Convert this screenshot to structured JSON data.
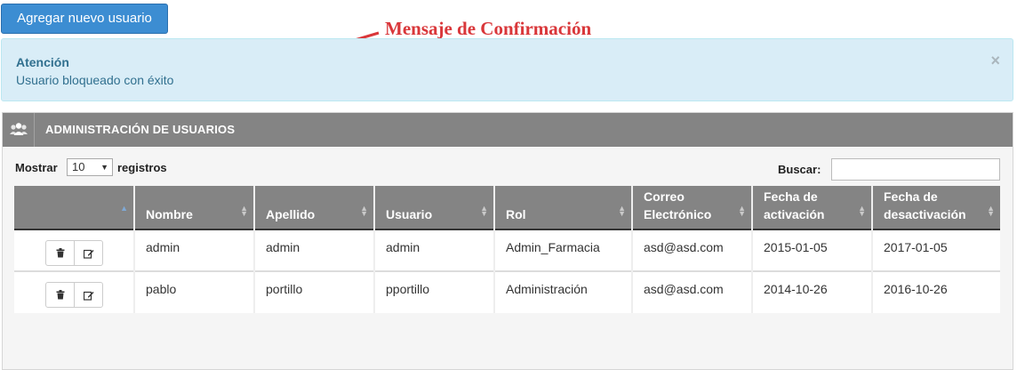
{
  "toolbar": {
    "add_user_label": "Agregar nuevo usuario"
  },
  "annotation": {
    "text": "Mensaje de Confirmación",
    "color": "#d9373a"
  },
  "alert": {
    "title": "Atención",
    "message": "Usuario bloqueado con éxito",
    "close": "×"
  },
  "panel": {
    "title": "ADMINISTRACIÓN DE USUARIOS",
    "icon": "users-icon"
  },
  "length": {
    "prefix": "Mostrar",
    "value": "10",
    "suffix": "registros"
  },
  "search": {
    "label": "Buscar:",
    "value": ""
  },
  "table": {
    "columns": [
      "",
      "Nombre",
      "Apellido",
      "Usuario",
      "Rol",
      "Correo Electrónico",
      "Fecha de activación",
      "Fecha de desactivación"
    ],
    "rows": [
      {
        "nombre": "admin",
        "apellido": "admin",
        "usuario": "admin",
        "rol": "Admin_Farmacia",
        "correo": "asd@asd.com",
        "activacion": "2015-01-05",
        "desactivacion": "2017-01-05"
      },
      {
        "nombre": "pablo",
        "apellido": "portillo",
        "usuario": "pportillo",
        "rol": "Administración",
        "correo": "asd@asd.com",
        "activacion": "2014-10-26",
        "desactivacion": "2016-10-26"
      }
    ],
    "row_actions": [
      "trash-icon",
      "edit-icon"
    ]
  },
  "colors": {
    "primary": "#3c8dd2",
    "alert_bg": "#d9edf7",
    "alert_text": "#31708f",
    "header_gray": "#848484"
  }
}
